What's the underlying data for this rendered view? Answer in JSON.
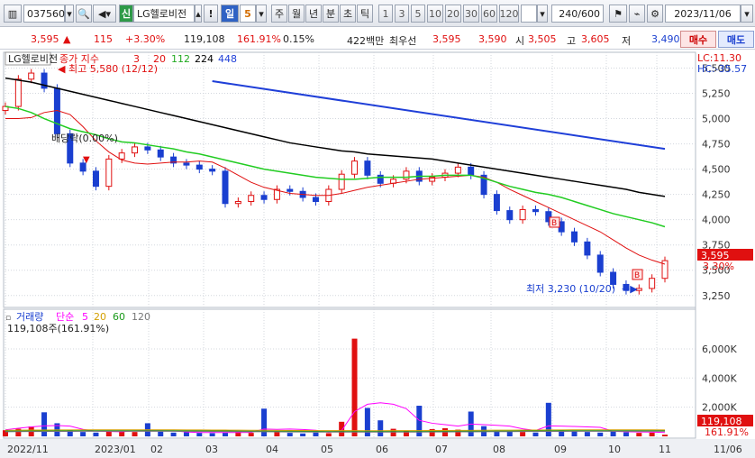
{
  "toolbar": {
    "code": "037560",
    "credit_badge": "신",
    "name": "LG헬로비전",
    "alert": "!",
    "period": "일",
    "interval": "5",
    "tabs": [
      "주",
      "월",
      "년",
      "분",
      "초",
      "틱"
    ],
    "nums": [
      "1",
      "3",
      "5",
      "10",
      "20",
      "30",
      "60",
      "120"
    ],
    "count": "240",
    "count_total": "/600",
    "date": "2023/11/06"
  },
  "quote": {
    "price": "3,595",
    "change": "115",
    "rate": "+3.30%",
    "volume": "119,108",
    "vol_rate": "161.91%",
    "turnover": "0.15%",
    "amount": "422백만",
    "best_label": "최우선",
    "best_bid": "3,595",
    "best_ask": "3,590",
    "open_label": "시",
    "open": "3,505",
    "high_label": "고",
    "high": "3,605",
    "low_label": "저",
    "low": "3,490",
    "buy": "매수",
    "sell": "매도"
  },
  "colors": {
    "up": "#e01010",
    "down": "#1a3fd0",
    "ma3": "#e01010",
    "ma20": "#e01010",
    "ma112": "#22cc22",
    "ma224": "#000000",
    "ma448": "#1f3fd8",
    "vma5": "#ff00ff",
    "vma20": "#d4a000",
    "vma60": "#1a9a1a",
    "vma120": "#777777"
  },
  "chart_data": {
    "type": "line",
    "title": "LG헬로비전",
    "legend": {
      "label": "종가 지수",
      "periods": [
        "3",
        "20",
        "112",
        "224",
        "448"
      ],
      "placement": "top-left"
    },
    "right_labels": {
      "lc": "LC:11.30",
      "hc": "HC:-35.57"
    },
    "y_ticks": [
      "5,500",
      "5,250",
      "5,000",
      "4,750",
      "4,500",
      "4,250",
      "4,000",
      "3,750",
      "3,500",
      "3,250"
    ],
    "ylim": [
      3150,
      5620
    ],
    "x_ticks": [
      "2022/11",
      "2023/01",
      "02",
      "03",
      "04",
      "05",
      "06",
      "07",
      "08",
      "09",
      "10",
      "11",
      "11/06"
    ],
    "close": [
      5120,
      5390,
      5450,
      5300,
      4850,
      4560,
      4480,
      4330,
      4600,
      4660,
      4720,
      4690,
      4620,
      4560,
      4540,
      4500,
      4480,
      4160,
      4180,
      4240,
      4200,
      4300,
      4280,
      4220,
      4180,
      4300,
      4450,
      4580,
      4440,
      4360,
      4400,
      4480,
      4380,
      4420,
      4460,
      4520,
      4440,
      4250,
      4090,
      4000,
      4100,
      4080,
      3980,
      3880,
      3780,
      3650,
      3480,
      3360,
      3300,
      3320,
      3420,
      3595
    ],
    "ma3": [
      5120,
      5250,
      5320,
      5380,
      5200,
      4900,
      4630,
      4450,
      4470,
      4530,
      4660,
      4690,
      4680,
      4620,
      4570,
      4530,
      4510,
      4380,
      4270,
      4190,
      4210,
      4250,
      4260,
      4270,
      4230,
      4230,
      4310,
      4440,
      4490,
      4460,
      4400,
      4410,
      4420,
      4430,
      4420,
      4470,
      4470,
      4400,
      4260,
      4110,
      4060,
      4060,
      4050,
      3980,
      3880,
      3770,
      3640,
      3500,
      3380,
      3330,
      3350,
      3445
    ],
    "ma20": [
      5000,
      5000,
      5010,
      5060,
      5080,
      5040,
      4920,
      4780,
      4670,
      4590,
      4560,
      4550,
      4560,
      4570,
      4570,
      4580,
      4570,
      4510,
      4440,
      4370,
      4320,
      4290,
      4260,
      4250,
      4240,
      4240,
      4260,
      4290,
      4320,
      4340,
      4360,
      4380,
      4400,
      4410,
      4420,
      4430,
      4440,
      4420,
      4370,
      4300,
      4240,
      4180,
      4120,
      4060,
      4000,
      3940,
      3880,
      3800,
      3720,
      3650,
      3600,
      3560
    ],
    "ma112": [
      5120,
      5100,
      5060,
      5000,
      4950,
      4900,
      4870,
      4840,
      4800,
      4770,
      4760,
      4740,
      4720,
      4700,
      4670,
      4650,
      4620,
      4590,
      4560,
      4530,
      4500,
      4480,
      4460,
      4440,
      4420,
      4410,
      4400,
      4400,
      4410,
      4420,
      4420,
      4420,
      4430,
      4430,
      4440,
      4440,
      4440,
      4410,
      4370,
      4330,
      4300,
      4270,
      4250,
      4220,
      4180,
      4140,
      4100,
      4060,
      4030,
      4000,
      3970,
      3930
    ],
    "ma224": [
      5400,
      5380,
      5360,
      5330,
      5300,
      5270,
      5240,
      5210,
      5180,
      5150,
      5120,
      5090,
      5060,
      5030,
      5000,
      4970,
      4940,
      4910,
      4880,
      4850,
      4820,
      4790,
      4760,
      4740,
      4720,
      4700,
      4680,
      4670,
      4650,
      4640,
      4630,
      4620,
      4610,
      4600,
      4580,
      4560,
      4540,
      4520,
      4500,
      4480,
      4460,
      4440,
      4420,
      4400,
      4380,
      4360,
      4340,
      4320,
      4300,
      4270,
      4250,
      4230
    ],
    "ma448": {
      "x_start_index": 16,
      "values_start": 5370,
      "values_end": 4700
    },
    "annotations": {
      "high": "최고 5,580 (12/12)",
      "low": "최저 3,230 (10/20)",
      "dividend": "배당락(0.00%)",
      "last_price": "3,595",
      "last_rate": "3.30%"
    },
    "volume": {
      "legend_label": "거래량",
      "legend_ma": "단순",
      "legend_periods": [
        "5",
        "20",
        "60",
        "120"
      ],
      "header": "119,108주(161.91%)",
      "y_ticks": [
        "6,000K",
        "4,000K",
        "2,000K"
      ],
      "ylim": [
        0,
        6800
      ],
      "last_volume": "119,108",
      "last_rate": "161.91%",
      "values_k": [
        420,
        520,
        680,
        1650,
        900,
        420,
        300,
        260,
        360,
        340,
        300,
        900,
        320,
        260,
        280,
        240,
        220,
        280,
        320,
        240,
        1900,
        300,
        240,
        200,
        260,
        220,
        1000,
        6700,
        1950,
        1100,
        520,
        400,
        2100,
        500,
        560,
        460,
        1700,
        700,
        380,
        340,
        300,
        260,
        2300,
        420,
        360,
        300,
        260,
        380,
        280,
        240,
        260,
        119
      ],
      "vma5_k": [
        450,
        560,
        650,
        720,
        740,
        700,
        480,
        360,
        330,
        320,
        380,
        400,
        390,
        380,
        300,
        260,
        260,
        260,
        260,
        270,
        500,
        480,
        500,
        470,
        420,
        280,
        400,
        1700,
        2200,
        2300,
        2200,
        1900,
        1100,
        900,
        800,
        700,
        840,
        800,
        760,
        700,
        520,
        400,
        720,
        700,
        680,
        650,
        620,
        350,
        320,
        300,
        290,
        260
      ]
    }
  }
}
